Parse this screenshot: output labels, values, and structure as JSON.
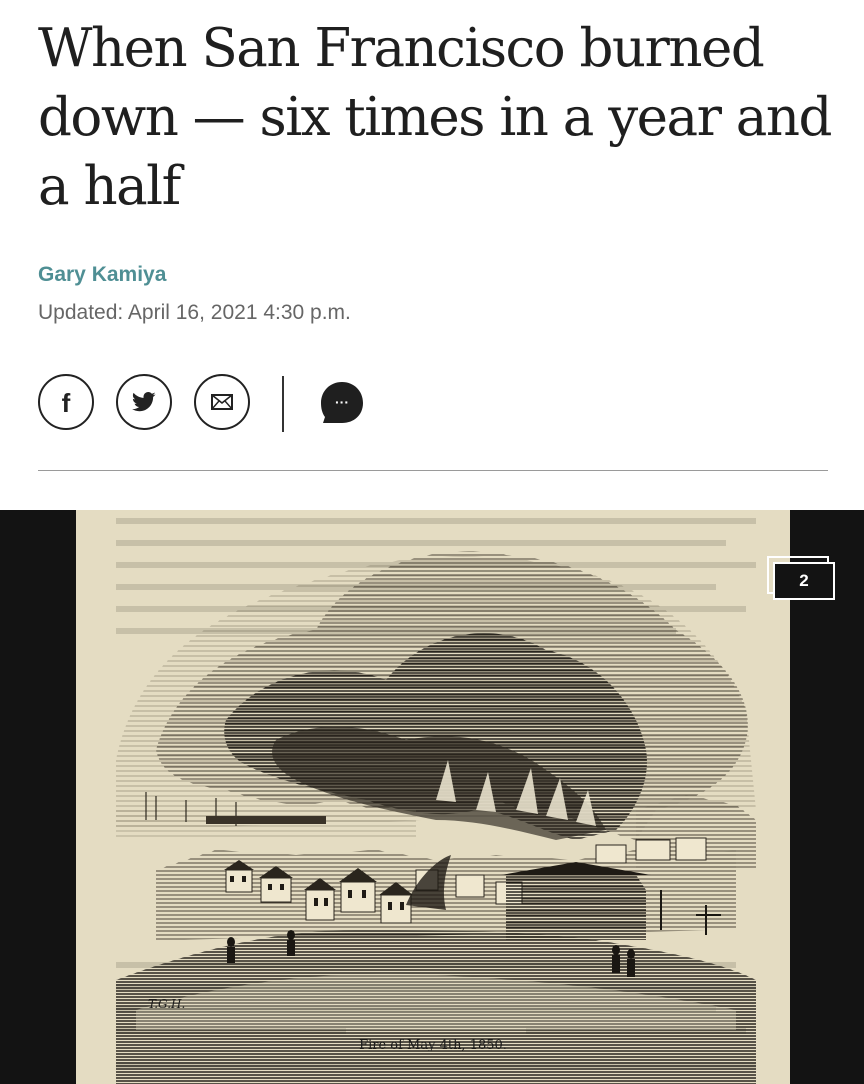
{
  "article": {
    "headline": "When San Francisco burned down — six times in a year and a half",
    "author": "Gary Kamiya",
    "updated": "Updated: April 16, 2021 4:30 p.m."
  },
  "share": {
    "facebook_icon": "f",
    "twitter_icon": "twitter-bird",
    "email_icon": "envelope",
    "comment_icon": "speech-bubble-ellipsis",
    "comment_glyph": "···"
  },
  "gallery": {
    "image_caption": "Fire of May 4th, 1850.",
    "engraver_initials": "T.G.H.",
    "photo_count": "2",
    "paper_color": "#e4dcc2",
    "ink_color": "#1c1c1c"
  },
  "colors": {
    "author_accent": "#4f8f94",
    "gallery_background": "#131313"
  }
}
